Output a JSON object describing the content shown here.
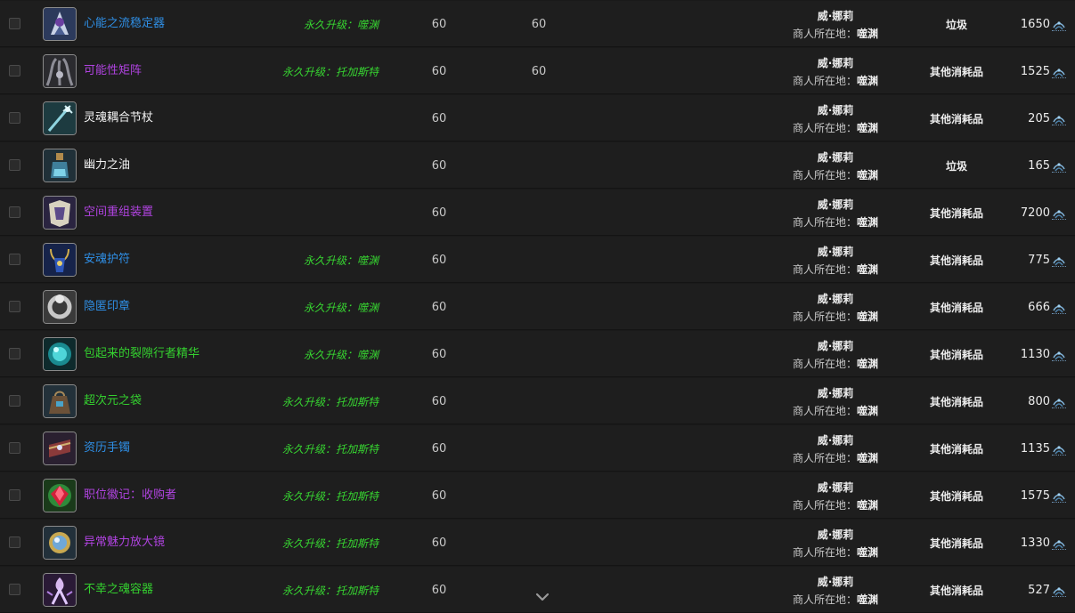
{
  "items": [
    {
      "name": "心能之流稳定器",
      "color": "blue",
      "upgrade": "永久升级：噬渊",
      "level": "60",
      "req": "60",
      "vendor": "威·娜莉",
      "loc_label": "商人所在地：",
      "loc": "噬渊",
      "category": "垃圾",
      "price": "1650",
      "icon": "mask-icon"
    },
    {
      "name": "可能性矩阵",
      "color": "purple",
      "upgrade": "永久升级：托加斯特",
      "level": "60",
      "req": "60",
      "vendor": "威·娜莉",
      "loc_label": "商人所在地：",
      "loc": "噬渊",
      "category": "其他消耗品",
      "price": "1525",
      "icon": "tentacle-icon"
    },
    {
      "name": "灵魂耦合节杖",
      "color": "white",
      "upgrade": "",
      "level": "60",
      "req": "",
      "vendor": "威·娜莉",
      "loc_label": "商人所在地：",
      "loc": "噬渊",
      "category": "其他消耗品",
      "price": "205",
      "icon": "staff-icon"
    },
    {
      "name": "幽力之油",
      "color": "white",
      "upgrade": "",
      "level": "60",
      "req": "",
      "vendor": "威·娜莉",
      "loc_label": "商人所在地：",
      "loc": "噬渊",
      "category": "垃圾",
      "price": "165",
      "icon": "potion-icon"
    },
    {
      "name": "空间重组装置",
      "color": "purple",
      "upgrade": "",
      "level": "60",
      "req": "",
      "vendor": "威·娜莉",
      "loc_label": "商人所在地：",
      "loc": "噬渊",
      "category": "其他消耗品",
      "price": "7200",
      "icon": "armor-icon"
    },
    {
      "name": "安魂护符",
      "color": "blue",
      "upgrade": "永久升级：噬渊",
      "level": "60",
      "req": "",
      "vendor": "威·娜莉",
      "loc_label": "商人所在地：",
      "loc": "噬渊",
      "category": "其他消耗品",
      "price": "775",
      "icon": "amulet-icon"
    },
    {
      "name": "隐匿印章",
      "color": "blue",
      "upgrade": "永久升级：噬渊",
      "level": "60",
      "req": "",
      "vendor": "威·娜莉",
      "loc_label": "商人所在地：",
      "loc": "噬渊",
      "category": "其他消耗品",
      "price": "666",
      "icon": "ring-icon"
    },
    {
      "name": "包起来的裂隙行者精华",
      "color": "green",
      "upgrade": "永久升级：噬渊",
      "level": "60",
      "req": "",
      "vendor": "威·娜莉",
      "loc_label": "商人所在地：",
      "loc": "噬渊",
      "category": "其他消耗品",
      "price": "1130",
      "icon": "orb-icon"
    },
    {
      "name": "超次元之袋",
      "color": "green",
      "upgrade": "永久升级：托加斯特",
      "level": "60",
      "req": "",
      "vendor": "威·娜莉",
      "loc_label": "商人所在地：",
      "loc": "噬渊",
      "category": "其他消耗品",
      "price": "800",
      "icon": "bag-icon"
    },
    {
      "name": "资历手镯",
      "color": "blue",
      "upgrade": "永久升级：托加斯特",
      "level": "60",
      "req": "",
      "vendor": "威·娜莉",
      "loc_label": "商人所在地：",
      "loc": "噬渊",
      "category": "其他消耗品",
      "price": "1135",
      "icon": "bracer-icon"
    },
    {
      "name": "职位徽记：收购者",
      "color": "purple",
      "upgrade": "永久升级：托加斯特",
      "level": "60",
      "req": "",
      "vendor": "威·娜莉",
      "loc_label": "商人所在地：",
      "loc": "噬渊",
      "category": "其他消耗品",
      "price": "1575",
      "icon": "gem-icon"
    },
    {
      "name": "异常魅力放大镜",
      "color": "purple",
      "upgrade": "永久升级：托加斯特",
      "level": "60",
      "req": "",
      "vendor": "威·娜莉",
      "loc_label": "商人所在地：",
      "loc": "噬渊",
      "category": "其他消耗品",
      "price": "1330",
      "icon": "lens-icon"
    },
    {
      "name": "不幸之魂容器",
      "color": "green",
      "upgrade": "永久升级：托加斯特",
      "level": "60",
      "req": "",
      "vendor": "威·娜莉",
      "loc_label": "商人所在地：",
      "loc": "噬渊",
      "category": "其他消耗品",
      "price": "527",
      "icon": "spirit-icon"
    }
  ],
  "palette": {
    "row_bg": "#1e1e1e",
    "blue": "#2f8fe6",
    "purple": "#b043e0",
    "green": "#34d12f",
    "white": "#f2f2f2"
  },
  "scroll_indicator_icon": "chevron-down-icon"
}
